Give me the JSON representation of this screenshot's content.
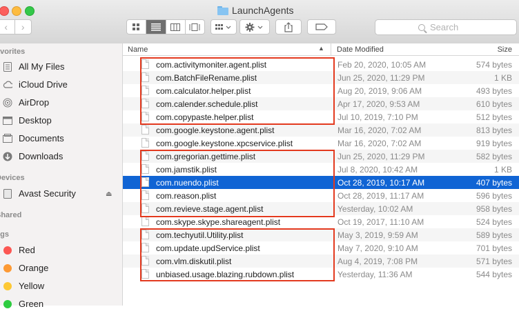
{
  "window": {
    "title": "LaunchAgents"
  },
  "toolbar": {
    "search_placeholder": "Search"
  },
  "sidebar": {
    "sections": [
      {
        "title": "avorites",
        "items": [
          {
            "label": "All My Files",
            "icon": "all-files-icon"
          },
          {
            "label": "iCloud Drive",
            "icon": "cloud-icon"
          },
          {
            "label": "AirDrop",
            "icon": "airdrop-icon"
          },
          {
            "label": "Desktop",
            "icon": "desktop-icon"
          },
          {
            "label": "Documents",
            "icon": "documents-icon"
          },
          {
            "label": "Downloads",
            "icon": "downloads-icon"
          }
        ]
      },
      {
        "title": "Devices",
        "items": [
          {
            "label": "Avast Security",
            "icon": "disk-icon"
          }
        ]
      },
      {
        "title": "Shared",
        "items": []
      },
      {
        "title": "ags",
        "items": [
          {
            "label": "Red",
            "color": "#fc5753"
          },
          {
            "label": "Orange",
            "color": "#fd9a34"
          },
          {
            "label": "Yellow",
            "color": "#fdc834"
          },
          {
            "label": "Green",
            "color": "#2ecc40"
          }
        ]
      }
    ]
  },
  "columns": {
    "name": "Name",
    "date": "Date Modified",
    "size": "Size"
  },
  "files": [
    {
      "name": "com.activitymoniter.agent.plist",
      "date": "Feb 20, 2020, 10:05 AM",
      "size": "574 bytes"
    },
    {
      "name": "com.BatchFileRename.plist",
      "date": "Jun 25, 2020, 11:29 PM",
      "size": "1 KB"
    },
    {
      "name": "com.calculator.helper.plist",
      "date": "Aug 20, 2019, 9:06 AM",
      "size": "493 bytes"
    },
    {
      "name": "com.calender.schedule.plist",
      "date": "Apr 17, 2020, 9:53 AM",
      "size": "610 bytes"
    },
    {
      "name": "com.copypaste.helper.plist",
      "date": "Jul 10, 2019, 7:10 PM",
      "size": "512 bytes"
    },
    {
      "name": "com.google.keystone.agent.plist",
      "date": "Mar 16, 2020, 7:02 AM",
      "size": "813 bytes"
    },
    {
      "name": "com.google.keystone.xpcservice.plist",
      "date": "Mar 16, 2020, 7:02 AM",
      "size": "919 bytes"
    },
    {
      "name": "com.gregorian.gettime.plist",
      "date": "Jun 25, 2020, 11:29 PM",
      "size": "582 bytes"
    },
    {
      "name": "com.jamstik.plist",
      "date": "Jul 8, 2020, 10:42 AM",
      "size": "1 KB"
    },
    {
      "name": "com.nuendo.plist",
      "date": "Oct 28, 2019, 10:17 AM",
      "size": "407 bytes",
      "selected": true
    },
    {
      "name": "com.reason.plist",
      "date": "Oct 28, 2019, 11:17 AM",
      "size": "596 bytes"
    },
    {
      "name": "com.revieve.stage.agent.plist",
      "date": "Yesterday, 10:02 AM",
      "size": "958 bytes"
    },
    {
      "name": "com.skype.skype.shareagent.plist",
      "date": "Oct 19, 2017, 11:10 AM",
      "size": "524 bytes"
    },
    {
      "name": "com.techyutil.Utility.plist",
      "date": "May 3, 2019, 9:59 AM",
      "size": "589 bytes"
    },
    {
      "name": "com.update.updService.plist",
      "date": "May 7, 2020, 9:10 AM",
      "size": "701 bytes"
    },
    {
      "name": "com.vlm.diskutil.plist",
      "date": "Aug 4, 2019, 7:08 PM",
      "size": "571 bytes"
    },
    {
      "name": "unbiased.usage.blazing.rubdown.plist",
      "date": "Yesterday, 11:36 AM",
      "size": "544 bytes"
    }
  ],
  "highlight_color": "#e3391e"
}
